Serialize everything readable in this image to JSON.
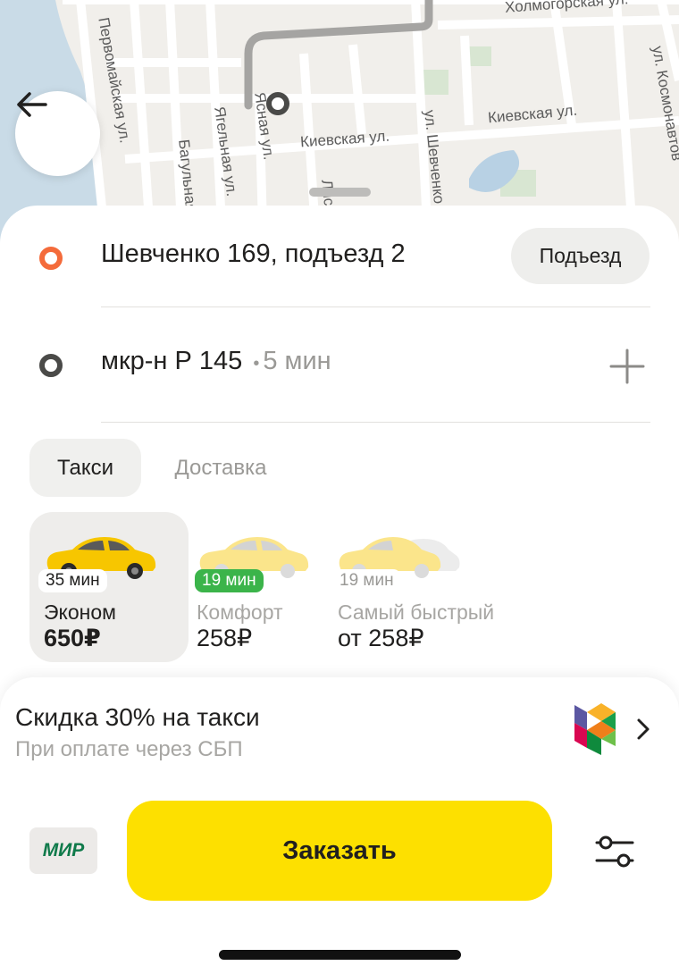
{
  "map": {
    "streets": [
      "Холмогорская ул.",
      "Первомайская ул.",
      "ул. Космонавтов",
      "Ясная ул.",
      "Ягельная ул.",
      "Багульная",
      "Киевская ул.",
      "Киевская ул.",
      "ул. Шевченко",
      "Лис"
    ],
    "icons": {
      "back": "arrow-left-icon"
    }
  },
  "route": {
    "origin": {
      "address": "Шевченко 169, подъезд 2",
      "button_label": "Подъезд",
      "color": "#f46b3b"
    },
    "destination": {
      "address": "мкр-н Р 145",
      "eta": "5 мин",
      "separator": "•",
      "color": "#4a4a48",
      "add_icon": "plus-icon"
    }
  },
  "tabs": [
    {
      "label": "Такси",
      "active": true
    },
    {
      "label": "Доставка",
      "active": false
    }
  ],
  "tariffs": [
    {
      "eta": "35 мин",
      "name": "Эконом",
      "price": "650₽",
      "selected": true
    },
    {
      "eta": "19 мин",
      "name": "Комфорт",
      "price": "258₽",
      "selected": false
    },
    {
      "eta": "19 мин",
      "name": "Самый быстрый",
      "price": "от 258₽",
      "selected": false
    }
  ],
  "promo": {
    "title": "Скидка 30% на такси",
    "subtitle": "При оплате через СБП",
    "logo": "sbp-logo-icon",
    "chevron": "chevron-right-icon"
  },
  "footer": {
    "payment_card": "МИР",
    "order_label": "Заказать",
    "order_color": "#fde000",
    "settings_icon": "sliders-icon"
  }
}
